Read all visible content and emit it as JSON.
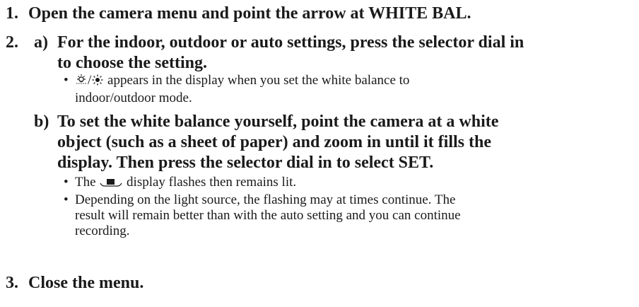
{
  "steps": {
    "s1": {
      "number": "1.",
      "text": "Open the camera menu and point the arrow at WHITE BAL."
    },
    "s2": {
      "number": "2.",
      "a": {
        "letter": "a)",
        "lines": [
          "For the indoor, outdoor or auto settings, press the selector dial in",
          "to choose the setting."
        ],
        "bullet": {
          "icons": [
            "indoor-bulb-icon",
            "outdoor-sun-icon"
          ],
          "separator": "/",
          "line1_after_icons": " appears in the display when you set the white balance to",
          "line2": "indoor/outdoor mode."
        }
      },
      "b": {
        "letter": "b)",
        "lines": [
          "To set the white balance yourself, point the camera at a white",
          "object (such as a sheet of paper) and zoom in until it fills the",
          "display. Then press the selector dial in to select SET."
        ],
        "bullet1": {
          "before_icon": "The ",
          "icon": "white-balance-set-icon",
          "after_icon": " display flashes then remains lit."
        },
        "bullet2": {
          "lines": [
            "Depending on the light source, the flashing may at times continue. The",
            "result will remain better than with the auto setting and you can continue",
            "recording."
          ]
        }
      }
    },
    "s3": {
      "number": "3.",
      "text": "Close the menu."
    }
  },
  "bullet_char": "•",
  "text_color": "#1a1a1a"
}
